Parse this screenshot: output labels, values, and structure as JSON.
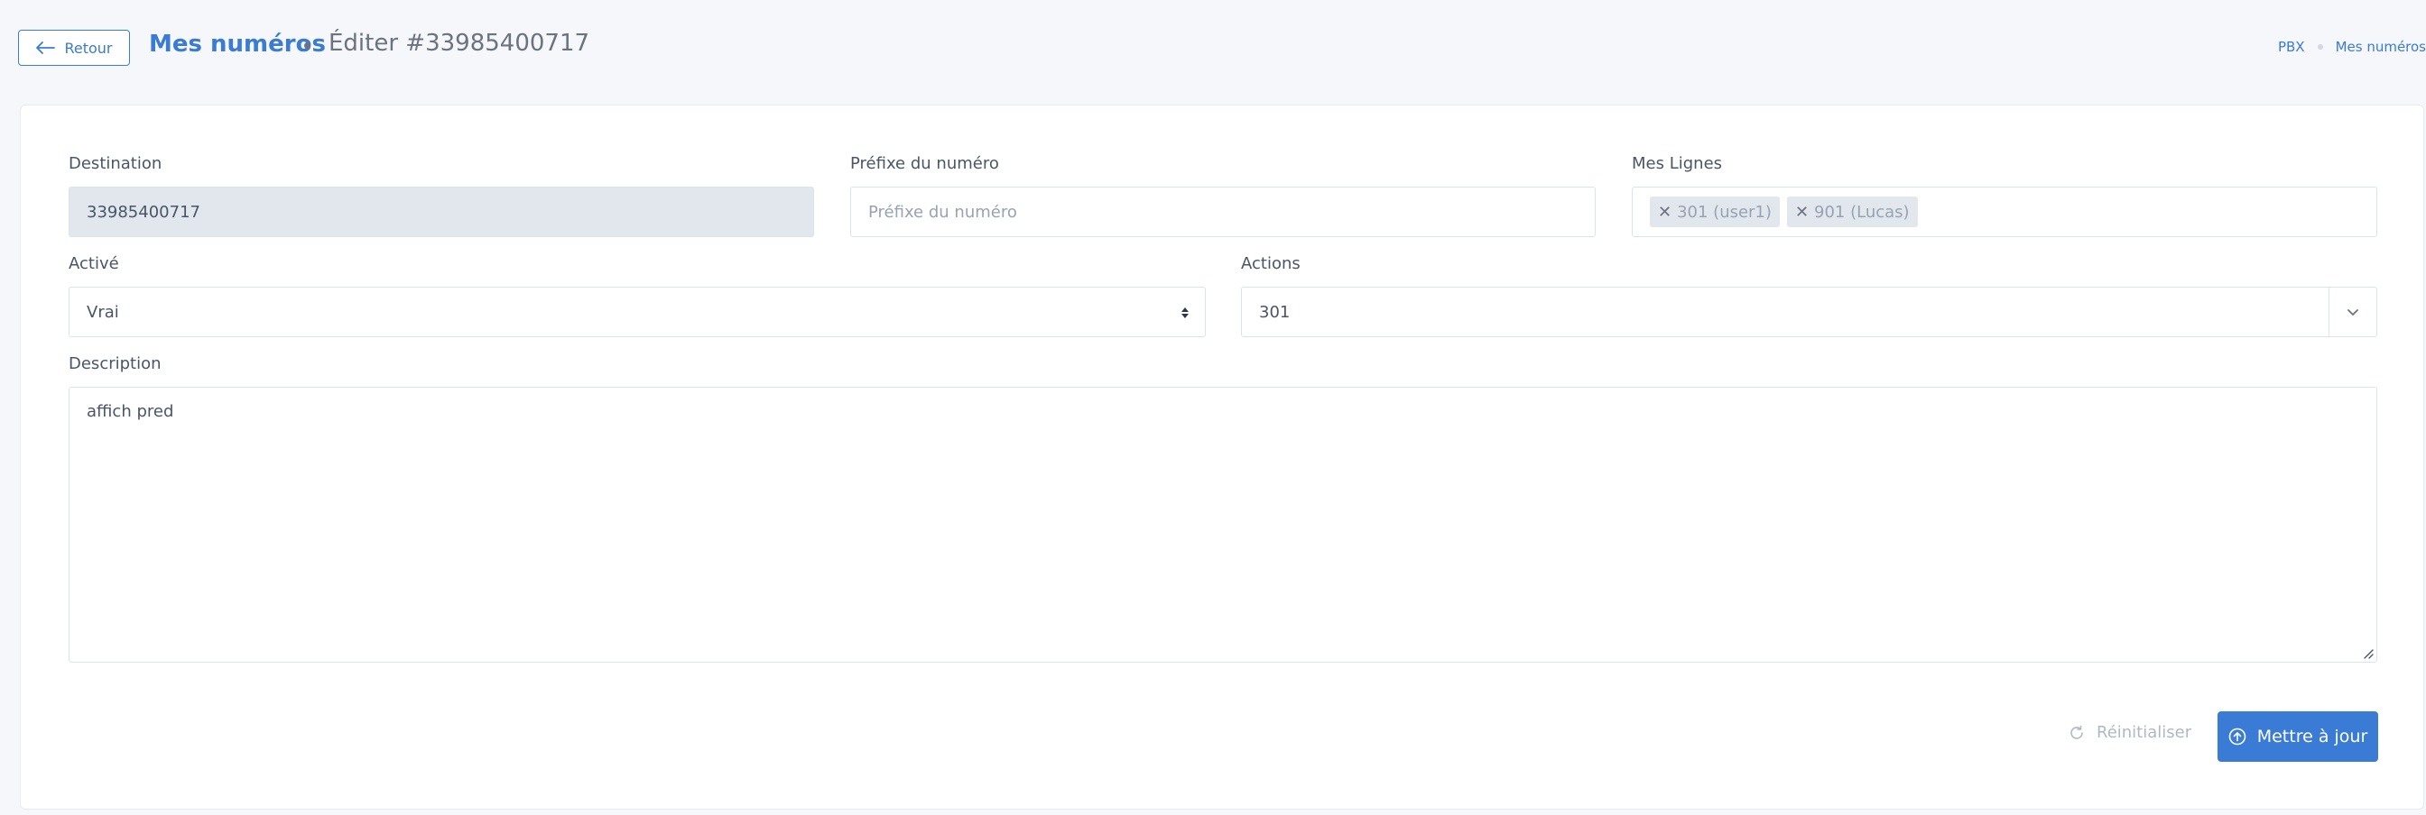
{
  "header": {
    "back_label": "Retour",
    "title": "Mes numéros",
    "edit_title": "Éditer #33985400717",
    "breadcrumb": [
      "PBX",
      "Mes numéros"
    ]
  },
  "form": {
    "destination": {
      "label": "Destination",
      "value": "33985400717"
    },
    "prefix": {
      "label": "Préfixe du numéro",
      "placeholder": "Préfixe du numéro"
    },
    "lines": {
      "label": "Mes Lignes",
      "tags": [
        "301 (user1)",
        "901 (Lucas)"
      ]
    },
    "active": {
      "label": "Activé",
      "value": "Vrai"
    },
    "actions": {
      "label": "Actions",
      "value": "301"
    },
    "description": {
      "label": "Description",
      "value": "affich pred"
    }
  },
  "buttons": {
    "reset_label": "Réinitialiser",
    "submit_label": "Mettre à jour"
  },
  "colors": {
    "primary": "#3a7bd5",
    "disabled_bg": "#e2e7ee",
    "border": "#dde3ec"
  },
  "icons": {
    "back": "arrow-left-icon",
    "remove_tag": "close-icon",
    "select": "sort-icon",
    "dropdown": "chevron-down-icon",
    "reset": "refresh-icon",
    "submit": "arrow-up-circle-icon"
  }
}
